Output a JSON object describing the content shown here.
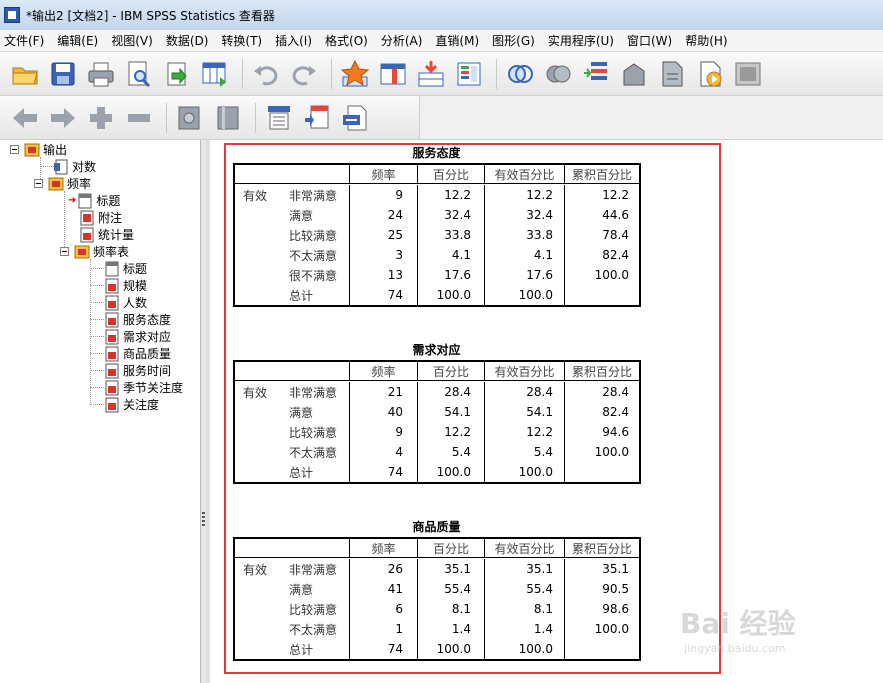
{
  "window": {
    "title": "*输出2 [文档2] - IBM SPSS Statistics 查看器"
  },
  "menu": [
    "文件(F)",
    "编辑(E)",
    "视图(V)",
    "数据(D)",
    "转换(T)",
    "插入(I)",
    "格式(O)",
    "分析(A)",
    "直销(M)",
    "图形(G)",
    "实用程序(U)",
    "窗口(W)",
    "帮助(H)"
  ],
  "toolbar1_icons": [
    "open-folder-icon",
    "save-icon",
    "print-icon",
    "print-preview-icon",
    "export-icon",
    "goto-data-icon",
    "undo-icon",
    "redo-icon",
    "goto-case-icon",
    "goto-variable-icon",
    "insert-case-icon",
    "variables-icon",
    "split-file-icon",
    "weight-cases-icon",
    "select-cases-icon",
    "value-labels-icon",
    "designate-window-icon",
    "run-script-icon",
    "hide-icon"
  ],
  "toolbar2_icons": [
    "back-arrow-icon",
    "forward-arrow-icon",
    "expand-icon",
    "collapse-icon",
    "show-icon",
    "hide-items-icon",
    "insert-heading-icon",
    "insert-title-icon",
    "insert-text-icon"
  ],
  "tree": {
    "root": "输出",
    "items": [
      {
        "label": "对数",
        "level": 1
      },
      {
        "label": "频率",
        "level": 1
      },
      {
        "label": "标题",
        "level": 2
      },
      {
        "label": "附注",
        "level": 2
      },
      {
        "label": "统计量",
        "level": 2
      },
      {
        "label": "频率表",
        "level": 2
      },
      {
        "label": "标题",
        "level": 3
      },
      {
        "label": "规模",
        "level": 3
      },
      {
        "label": "人数",
        "level": 3
      },
      {
        "label": "服务态度",
        "level": 3
      },
      {
        "label": "需求对应",
        "level": 3
      },
      {
        "label": "商品质量",
        "level": 3
      },
      {
        "label": "服务时间",
        "level": 3
      },
      {
        "label": "季节关注度",
        "level": 3
      },
      {
        "label": "关注度",
        "level": 3
      }
    ]
  },
  "table_headers": [
    "频率",
    "百分比",
    "有效百分比",
    "累积百分比"
  ],
  "tables": [
    {
      "title": "服务态度",
      "group": "有效",
      "rows": [
        {
          "label": "非常满意",
          "freq": "9",
          "pct": "12.2",
          "valid": "12.2",
          "cum": "12.2"
        },
        {
          "label": "满意",
          "freq": "24",
          "pct": "32.4",
          "valid": "32.4",
          "cum": "44.6"
        },
        {
          "label": "比较满意",
          "freq": "25",
          "pct": "33.8",
          "valid": "33.8",
          "cum": "78.4"
        },
        {
          "label": "不太满意",
          "freq": "3",
          "pct": "4.1",
          "valid": "4.1",
          "cum": "82.4"
        },
        {
          "label": "很不满意",
          "freq": "13",
          "pct": "17.6",
          "valid": "17.6",
          "cum": "100.0"
        },
        {
          "label": "总计",
          "freq": "74",
          "pct": "100.0",
          "valid": "100.0",
          "cum": ""
        }
      ]
    },
    {
      "title": "需求对应",
      "group": "有效",
      "rows": [
        {
          "label": "非常满意",
          "freq": "21",
          "pct": "28.4",
          "valid": "28.4",
          "cum": "28.4"
        },
        {
          "label": "满意",
          "freq": "40",
          "pct": "54.1",
          "valid": "54.1",
          "cum": "82.4"
        },
        {
          "label": "比较满意",
          "freq": "9",
          "pct": "12.2",
          "valid": "12.2",
          "cum": "94.6"
        },
        {
          "label": "不太满意",
          "freq": "4",
          "pct": "5.4",
          "valid": "5.4",
          "cum": "100.0"
        },
        {
          "label": "总计",
          "freq": "74",
          "pct": "100.0",
          "valid": "100.0",
          "cum": ""
        }
      ]
    },
    {
      "title": "商品质量",
      "group": "有效",
      "rows": [
        {
          "label": "非常满意",
          "freq": "26",
          "pct": "35.1",
          "valid": "35.1",
          "cum": "35.1"
        },
        {
          "label": "满意",
          "freq": "41",
          "pct": "55.4",
          "valid": "55.4",
          "cum": "90.5"
        },
        {
          "label": "比较满意",
          "freq": "6",
          "pct": "8.1",
          "valid": "8.1",
          "cum": "98.6"
        },
        {
          "label": "不太满意",
          "freq": "1",
          "pct": "1.4",
          "valid": "1.4",
          "cum": "100.0"
        },
        {
          "label": "总计",
          "freq": "74",
          "pct": "100.0",
          "valid": "100.0",
          "cum": ""
        }
      ]
    }
  ],
  "watermark": {
    "text": "Bai 经验",
    "url": "jingyan.baidu.com"
  },
  "colors": {
    "highlight": "#e23a3a",
    "titlebar": "#c3d6ec"
  }
}
